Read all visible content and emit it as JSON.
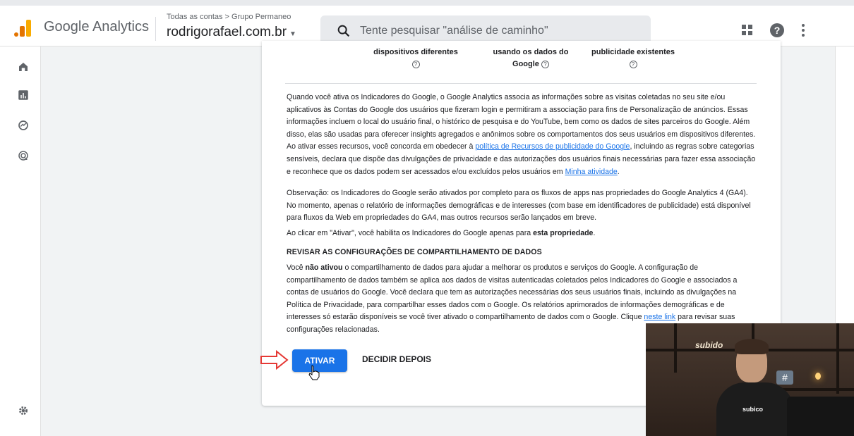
{
  "header": {
    "app_name": "Google Analytics",
    "breadcrumb": "Todas as contas > Grupo Permaneo",
    "property": "rodrigorafael.com.br",
    "search_placeholder": "Tente pesquisar \"análise de caminho\""
  },
  "features": [
    {
      "line1": "dispositivos diferentes",
      "line2": ""
    },
    {
      "line1": "usando os dados do",
      "line2": "Google"
    },
    {
      "line1": "publicidade existentes",
      "line2": ""
    }
  ],
  "content": {
    "p1_a": "Quando você ativa os Indicadores do Google, o Google Analytics associa as informações sobre as visitas coletadas no seu site e/ou aplicativos às Contas do Google dos usuários que fizeram login e permitiram a associação para fins de Personalização de anúncios. Essas informações incluem o local do usuário final, o histórico de pesquisa e do YouTube, bem como os dados de sites parceiros do Google. Além disso, elas são usadas para oferecer insights agregados e anônimos sobre os comportamentos dos seus usuários em dispositivos diferentes. Ao ativar esses recursos, você concorda em obedecer à ",
    "p1_link1": "política de Recursos de publicidade do Google",
    "p1_b": ", incluindo as regras sobre categorias sensíveis, declara que dispõe das divulgações de privacidade e das autorizações dos usuários finais necessárias para fazer essa associação e reconhece que os dados podem ser acessados e/ou excluídos pelos usuários em ",
    "p1_link2": "Minha atividade",
    "p1_c": ".",
    "p2": "Observação: os Indicadores do Google serão ativados por completo para os fluxos de apps nas propriedades do Google Analytics 4 (GA4). No momento, apenas o relatório de informações demográficas e de interesses (com base em identificadores de publicidade) está disponível para fluxos da Web em propriedades do GA4, mas outros recursos serão lançados em breve.",
    "p3_a": "Ao clicar em \"Ativar\", você habilita os Indicadores do Google apenas para ",
    "p3_bold": "esta propriedade",
    "p3_c": ".",
    "section_heading": "REVISAR AS CONFIGURAÇÕES DE COMPARTILHAMENTO DE DADOS",
    "p4_a": "Você ",
    "p4_bold": "não ativou",
    "p4_b": " o compartilhamento de dados para ajudar a melhorar os produtos e serviços do Google. A configuração de compartilhamento de dados também se aplica aos dados de visitas autenticadas coletados pelos Indicadores do Google e associados a contas de usuários do Google. Você declara que tem as autorizações necessárias dos seus usuários finais, incluindo as divulgações na Política de Privacidade, para compartilhar esses dados com o Google. Os relatórios aprimorados de informações demográficas e de interesses só estarão disponíveis se você tiver ativado o compartilhamento de dados com o Google. Clique ",
    "p4_link": "neste link",
    "p4_c": " para revisar suas configurações relacionadas."
  },
  "actions": {
    "activate": "ATIVAR",
    "later": "DECIDIR DEPOIS"
  },
  "webcam": {
    "sign": "subido",
    "shirt": "subico",
    "hash": "#"
  },
  "colors": {
    "accent": "#1a73e8",
    "logo_orange": "#e37400",
    "logo_yellow": "#f9ab00",
    "arrow_red": "#e53935"
  }
}
